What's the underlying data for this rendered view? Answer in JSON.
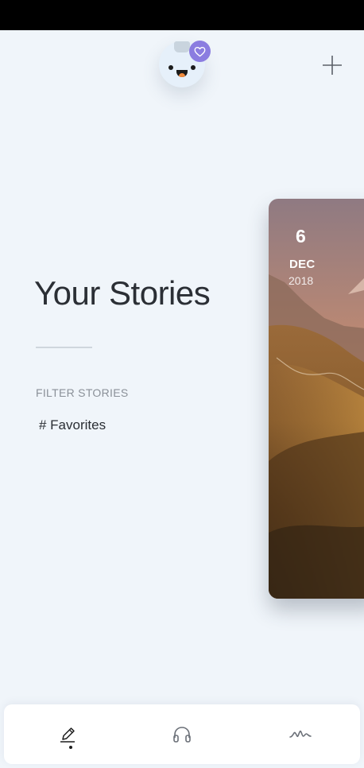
{
  "header": {
    "avatar_icon": "smiling-robot-avatar",
    "badge_icon": "heart-icon",
    "badge_color": "#8b7de0",
    "add_icon": "plus-icon"
  },
  "main": {
    "title": "Your Stories",
    "filter_heading": "FILTER STORIES",
    "filters": [
      "# Favorites"
    ]
  },
  "story_card": {
    "day": "6",
    "month": "DEC",
    "year": "2018",
    "image": "mountain-landscape-sunset"
  },
  "bottom_nav": {
    "items": [
      {
        "icon": "pencil-icon",
        "active": true
      },
      {
        "icon": "headphones-icon",
        "active": false
      },
      {
        "icon": "waveform-icon",
        "active": false
      }
    ]
  }
}
